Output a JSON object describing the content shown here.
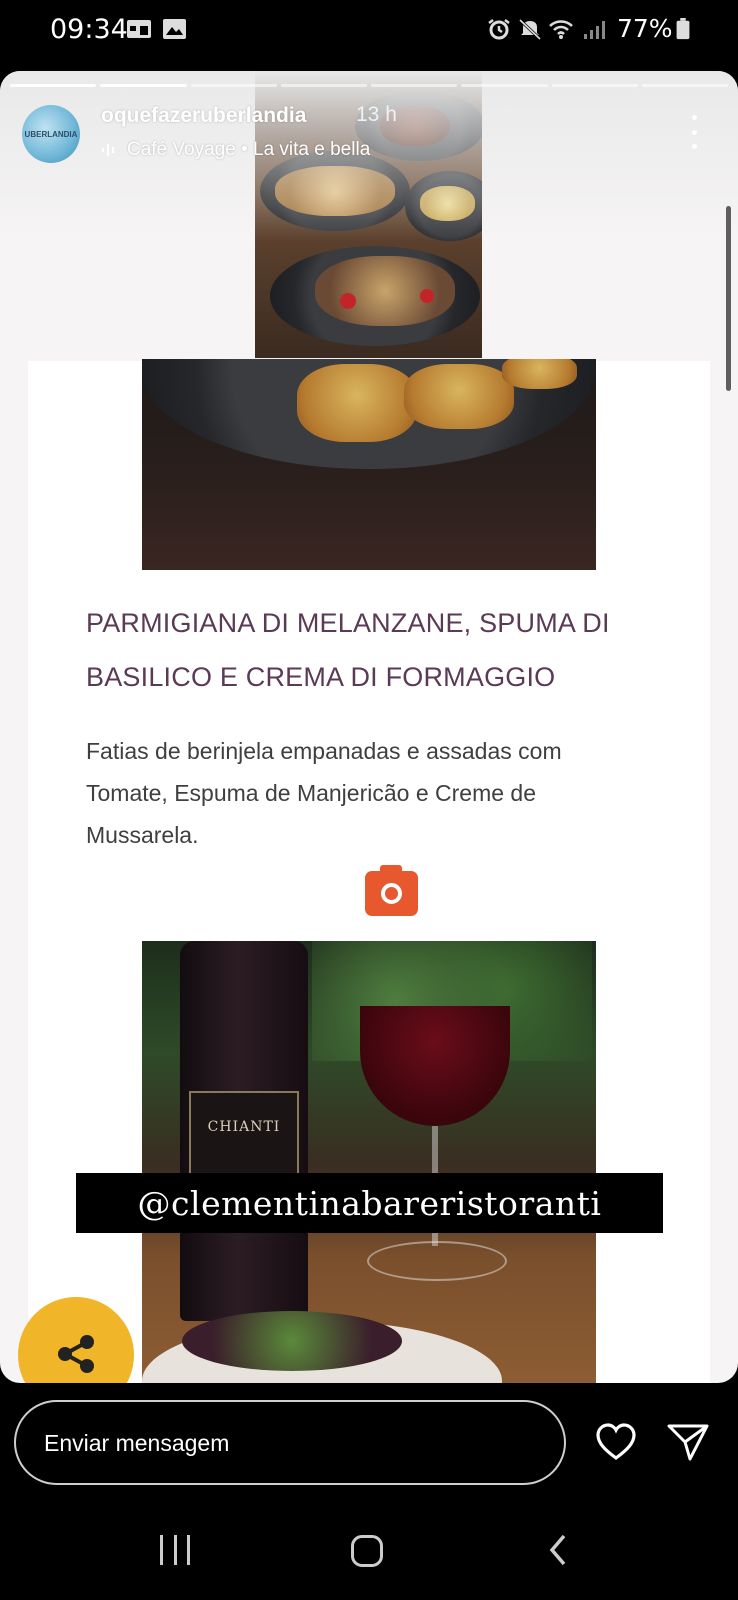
{
  "status_bar": {
    "time": "09:34",
    "battery": "77%",
    "icons": [
      "calendar-icon",
      "gallery-icon",
      "alarm-icon",
      "mute-icon",
      "wifi-icon",
      "signal-icon",
      "battery-icon"
    ]
  },
  "story": {
    "username": "oquefazeruberlandia",
    "time_ago": "13 h",
    "avatar_text": "UBERLANDIA",
    "music": "Café Voyage • La vita e bella",
    "progress": {
      "total_segments": 8,
      "completed_segments": 2
    }
  },
  "content": {
    "dish_title": "PARMIGIANA DI MELANZANE, SPUMA DI BASILICO E CREMA DI FORMAGGIO",
    "dish_description": "Fatias de berinjela empanadas e assadas com Tomate, Espuma de Manjericão e Creme de Mussarela.",
    "wine_label": "CHIANTI"
  },
  "mention_sticker": "@clementinabareristoranti",
  "reply": {
    "placeholder": "Enviar mensagem"
  },
  "colors": {
    "title": "#5a3a55",
    "camera_accent": "#e8582f",
    "share_button": "#f0b528"
  }
}
